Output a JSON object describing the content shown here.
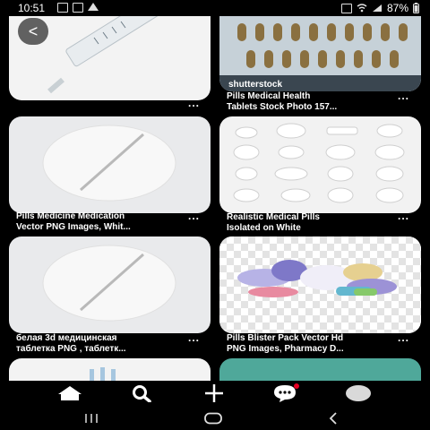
{
  "status_bar": {
    "time": "10:51",
    "battery": "87%"
  },
  "back_label": "<",
  "watermark": "shutterstock",
  "feed": {
    "pins": [
      {
        "title_line1": "Pills Medical Health",
        "title_line2": "Tablets Stock Photo 157..."
      },
      {
        "title_line1": "Pills Medicine Medication",
        "title_line2": "Vector PNG Images, Whit..."
      },
      {
        "title_line1": "Realistic Medical Pills",
        "title_line2": "Isolated on White"
      },
      {
        "title_line1": "белая 3d медицинская",
        "title_line2": "таблетка PNG , таблетк..."
      },
      {
        "title_line1": "Pills Blister Pack Vector Hd",
        "title_line2": "PNG Images, Pharmacy D..."
      }
    ],
    "more_label": "..."
  },
  "tabbar": {
    "items": [
      "home",
      "search",
      "create",
      "messages",
      "profile"
    ],
    "active": "search",
    "notification_color": "#e60023"
  },
  "navbar": {
    "recents": "III",
    "home": "O",
    "back": "<"
  }
}
